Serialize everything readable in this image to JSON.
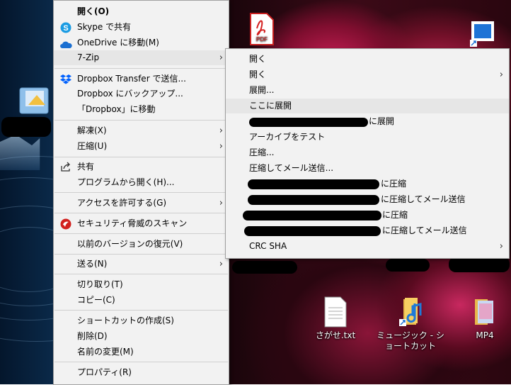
{
  "main_menu": {
    "items": [
      {
        "label": "開く(O)",
        "bold": true
      },
      {
        "label": "Skype で共有"
      },
      {
        "label": "OneDrive に移動(M)"
      },
      {
        "label": "7-Zip",
        "submenu": true
      },
      {
        "label": "Dropbox Transfer で送信..."
      },
      {
        "label": "Dropbox にバックアップ..."
      },
      {
        "label": "「Dropbox」に移動"
      },
      {
        "label": "解凍(X)",
        "submenu": true
      },
      {
        "label": "圧縮(U)",
        "submenu": true
      },
      {
        "label": "共有"
      },
      {
        "label": "プログラムから開く(H)..."
      },
      {
        "label": "アクセスを許可する(G)",
        "submenu": true
      },
      {
        "label": "セキュリティ脅威のスキャン"
      },
      {
        "label": "以前のバージョンの復元(V)"
      },
      {
        "label": "送る(N)",
        "submenu": true
      },
      {
        "label": "切り取り(T)"
      },
      {
        "label": "コピー(C)"
      },
      {
        "label": "ショートカットの作成(S)"
      },
      {
        "label": "削除(D)"
      },
      {
        "label": "名前の変更(M)"
      },
      {
        "label": "プロパティ(R)"
      }
    ]
  },
  "zip_submenu": {
    "items": [
      {
        "label": "開く"
      },
      {
        "label": "開く",
        "submenu": true
      },
      {
        "label": "展開..."
      },
      {
        "label": "ここに展開",
        "highlighted": true
      },
      {
        "label": "に展開"
      },
      {
        "label": "アーカイブをテスト"
      },
      {
        "label": "圧縮..."
      },
      {
        "label": "圧縮してメール送信..."
      },
      {
        "label": "に圧縮"
      },
      {
        "label": "に圧縮してメール送信"
      },
      {
        "label": "に圧縮"
      },
      {
        "label": "に圧縮してメール送信"
      },
      {
        "label": "CRC SHA",
        "submenu": true
      }
    ]
  },
  "desktop": {
    "icons": [
      {
        "label": "さがせ.txt"
      },
      {
        "label": "ミュージック - ショートカット"
      },
      {
        "label": "MP4"
      }
    ]
  },
  "icons": {
    "submenu_arrow": "›",
    "skype": "S",
    "pdf": "PDF"
  }
}
